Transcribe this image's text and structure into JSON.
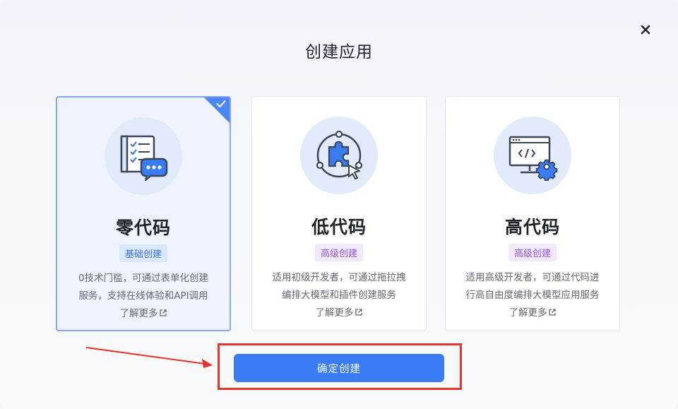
{
  "dialog": {
    "title": "创建应用",
    "close_icon": "close-icon"
  },
  "cards": [
    {
      "id": "zero-code",
      "name": "零代码",
      "badge": "基础创建",
      "desc_line1": "0技术门槛，可通过表单化创建",
      "desc_line2": "服务，支持在线体验和API调用",
      "more": "了解更多",
      "icon": "form-chat-icon",
      "selected": true
    },
    {
      "id": "low-code",
      "name": "低代码",
      "badge": "高级创建",
      "desc_line1": "适用初级开发者，可通过拖拉拽",
      "desc_line2": "编排大模型和插件创建服务",
      "more": "了解更多",
      "icon": "puzzle-icon",
      "selected": false
    },
    {
      "id": "high-code",
      "name": "高代码",
      "badge": "高级创建",
      "desc_line1": "适用高级开发者，可通过代码进",
      "desc_line2": "行高自由度编排大模型应用服务",
      "more": "了解更多",
      "icon": "code-monitor-icon",
      "selected": false
    }
  ],
  "footer": {
    "confirm_label": "确定创建"
  },
  "colors": {
    "primary": "#3a7cf4",
    "selected_border": "#84a7f0",
    "annotation_red": "#e8342e"
  }
}
